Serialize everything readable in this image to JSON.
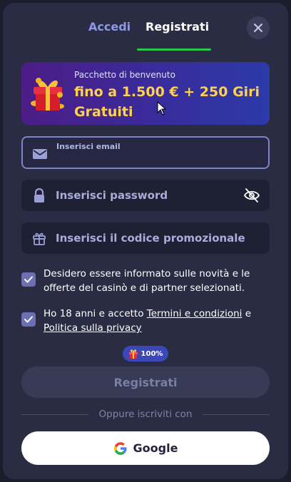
{
  "tabs": {
    "login_label": "Accedi",
    "register_label": "Registrati",
    "active": "register"
  },
  "banner": {
    "subtitle": "Pacchetto di benvenuto",
    "title": "fino a 1.500 € + 250 Giri Gratuiti"
  },
  "form": {
    "email_label": "Inserisci email",
    "password_placeholder": "Inserisci password",
    "promo_placeholder": "Inserisci il codice promozionale"
  },
  "checks": {
    "news_text": "Desidero essere informato sulle novità e le offerte del casinò e di partner selezionati.",
    "news_checked": true,
    "age_text_prefix": "Ho 18 anni e accetto ",
    "terms_link": "Termini e condizioni",
    "age_text_mid": " e ",
    "privacy_link": "Politica sulla privacy",
    "age_checked": true
  },
  "badge": {
    "label": "100%",
    "icon": "gift-icon"
  },
  "register_button": "Registrati",
  "divider_text": "Oppure iscriviti con",
  "google_button": "Google",
  "colors": {
    "accent_green": "#2cc74a",
    "tab_inactive": "#8f97e8",
    "banner_title": "#ffd24a",
    "modal_bg": "#2a2c43"
  }
}
